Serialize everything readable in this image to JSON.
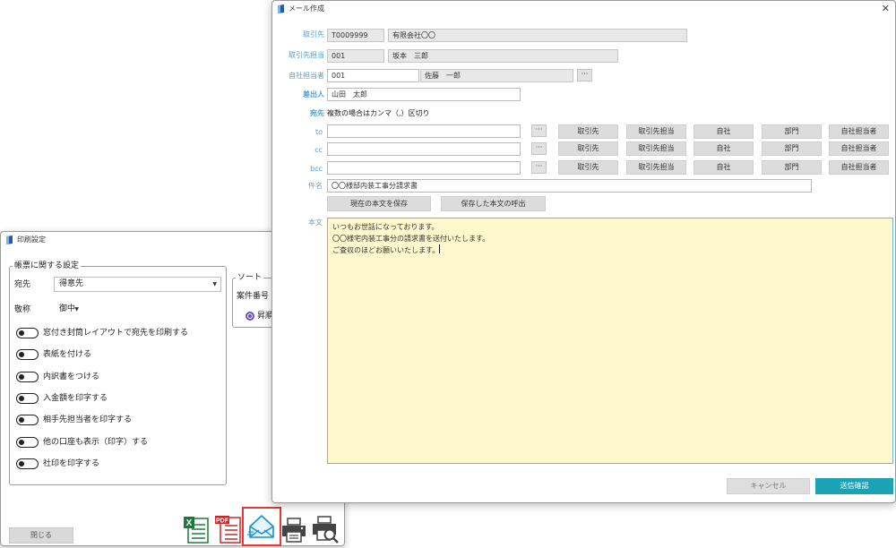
{
  "print_window": {
    "title": "印刷設定",
    "group_main": "帳票に関する設定",
    "recipient_label": "宛先",
    "recipient_value": "得意先",
    "honorific_label": "敬称",
    "honorific_value": "御中",
    "group_sort": "ソート",
    "sort_key": "案件番号",
    "sort_order": "昇順",
    "toggles": [
      "窓付き封筒レイアウトで宛先を印刷する",
      "表紙を付ける",
      "内訳書をつける",
      "入金額を印字する",
      "相手先担当者を印字する",
      "他の口座も表示（印字）する",
      "社印を印字する"
    ],
    "close_label": "閉じる"
  },
  "toolbar": {
    "excel_icon": "excel-export-icon",
    "pdf_icon": "pdf-export-icon",
    "pdf_text": "PDF",
    "mail_icon": "mail-send-icon",
    "print_icon": "printer-icon",
    "preview_icon": "print-preview-icon",
    "highlight_color": "#e53935"
  },
  "mail_window": {
    "title": "メール作成",
    "client_label": "取引先",
    "client_code": "T0009999",
    "client_name": "有限会社〇〇",
    "client_contact_label": "取引先担当",
    "client_contact_code": "001",
    "client_contact_name": "坂本　三郎",
    "own_contact_label": "自社担当者",
    "own_contact_code": "001",
    "own_contact_name": "佐藤　一郎",
    "sender_label": "差出人",
    "sender_value": "山田　太郎",
    "to_header_label": "宛先",
    "to_hint": "複数の場合はカンマ（,）区切り",
    "rows": [
      {
        "label": "to",
        "value": ""
      },
      {
        "label": "cc",
        "value": ""
      },
      {
        "label": "bcc",
        "value": ""
      }
    ],
    "dots": "···",
    "categories": [
      "取引先",
      "取引先担当",
      "自社",
      "部門",
      "自社担当者"
    ],
    "subject_label": "件名",
    "subject_value": "〇〇様邸内装工事分請求書",
    "save_body_label": "現在の本文を保存",
    "load_body_label": "保存した本文の呼出",
    "body_label": "本文",
    "body_lines": [
      "いつもお世話になっております。",
      "〇〇様宅内装工事分の請求書を送付いたします。",
      "ご査収のほどお願いいたします。"
    ],
    "cancel_label": "キャンセル",
    "send_label": "送信確認",
    "accent_color": "#1ba3b5",
    "body_bg": "#fff8cc"
  }
}
